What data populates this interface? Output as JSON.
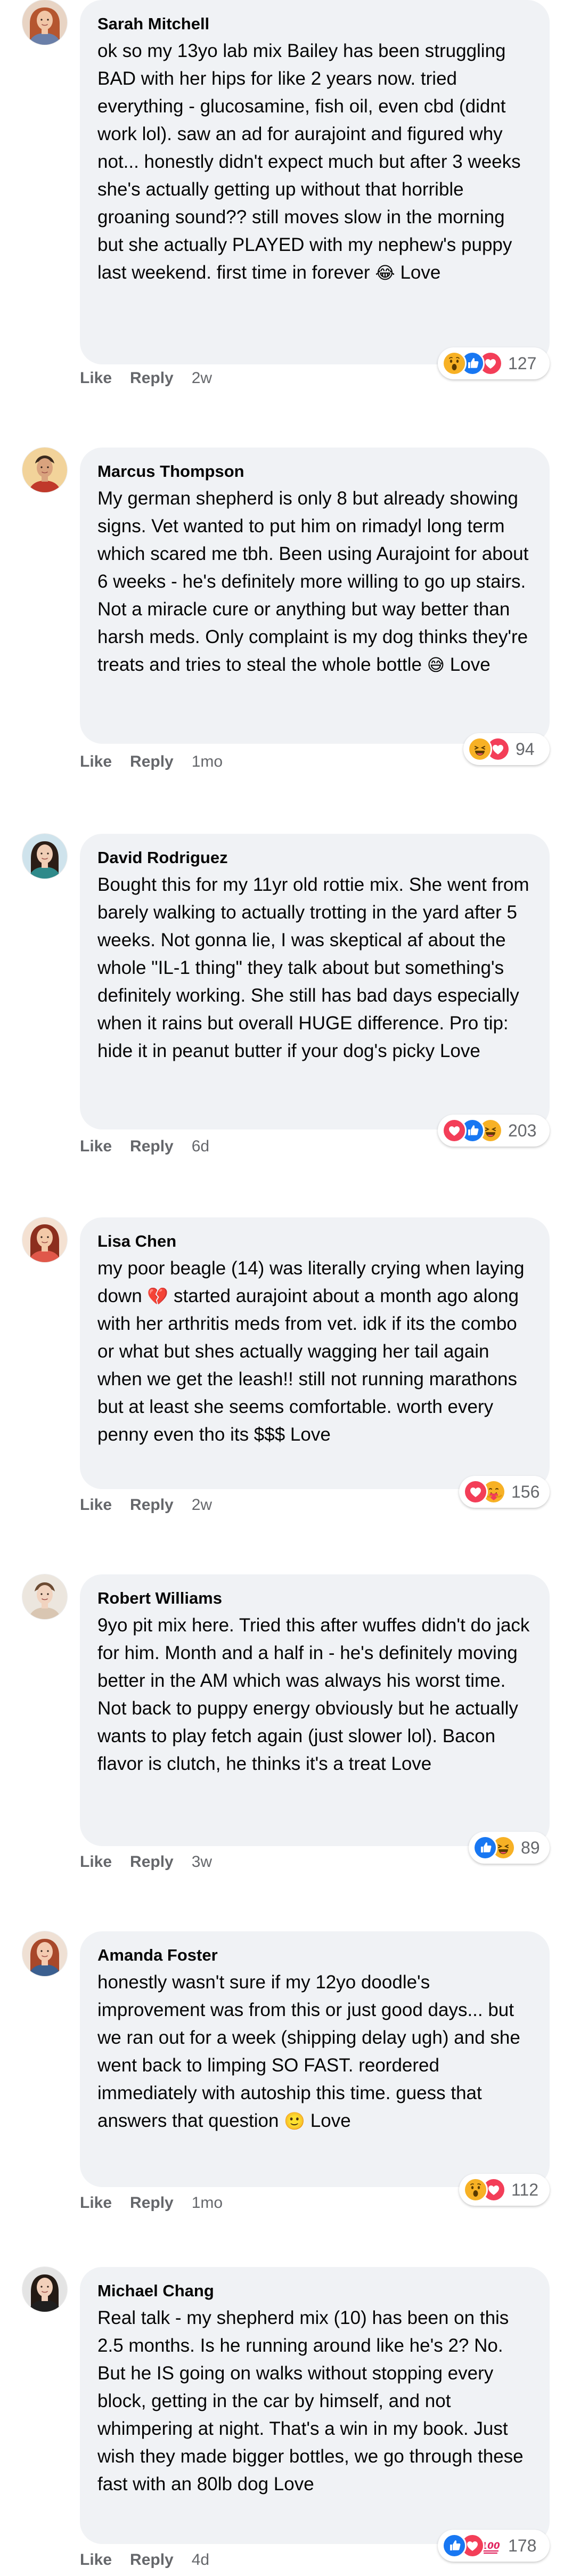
{
  "comments": [
    {
      "author": "Sarah Mitchell",
      "text": "ok so my 13yo lab mix Bailey has been struggling BAD with her hips for like 2 years now. tried everything - glucosamine, fish oil, even cbd (didnt work lol). saw an ad for aurajoint and figured why not... honestly didn't expect much but after 3 weeks she's actually getting up without that horrible groaning sound?? still moves slow in the morning but she actually PLAYED with my nephew's puppy last weekend. first time in forever",
      "emoji": "😂",
      "suffix": "Love",
      "reactions": [
        "wow",
        "like",
        "love"
      ],
      "reaction_count": "127",
      "like_label": "Like",
      "reply_label": "Reply",
      "time": "2w",
      "avatar": {
        "skin": "#f1c6a6",
        "hair": "#b5562f",
        "bg": "#e8d4c4",
        "shirt": "#6a7fa8"
      }
    },
    {
      "author": "Marcus Thompson",
      "text": "My german shepherd is only 8 but already showing signs. Vet wanted to put him on rimadyl long term which scared me tbh. Been using Aurajoint for about 6 weeks - he's definitely more willing to go up stairs. Not a miracle cure or anything but way better than harsh meds. Only complaint is my dog thinks they're treats and tries to steal the whole bottle",
      "emoji": "😅",
      "suffix": "Love",
      "reactions": [
        "haha",
        "love"
      ],
      "reaction_count": "94",
      "like_label": "Like",
      "reply_label": "Reply",
      "time": "1mo",
      "avatar": {
        "skin": "#d9a37e",
        "hair": "#3a2a1e",
        "bg": "#f2d39a",
        "shirt": "#c0392b"
      }
    },
    {
      "author": "David Rodriguez",
      "text": "Bought this for my 11yr old rottie mix. She went from barely walking to actually trotting in the yard after 5 weeks. Not gonna lie, I was skeptical af about the whole \"IL-1 thing\" they talk about but something's definitely working. She still has bad days especially when it rains but overall HUGE difference. Pro tip: hide it in peanut butter if your dog's picky Love",
      "emoji": "",
      "suffix": "",
      "reactions": [
        "love",
        "like",
        "haha"
      ],
      "reaction_count": "203",
      "like_label": "Like",
      "reply_label": "Reply",
      "time": "6d",
      "avatar": {
        "skin": "#f0cdb5",
        "hair": "#2b1d16",
        "bg": "#cfe3ec",
        "shirt": "#2f8a8a"
      }
    },
    {
      "author": "Lisa Chen",
      "text": "my poor beagle (14) was literally crying when laying down",
      "emoji": "💔",
      "text2": "started aurajoint about a month ago along with her arthritis meds from vet. idk if its the combo or what but shes actually wagging her tail again when we get the leash!! still not running marathons but at least she seems comfortable. worth every penny even tho its $$$ Love",
      "suffix": "",
      "reactions": [
        "love",
        "care"
      ],
      "reaction_count": "156",
      "like_label": "Like",
      "reply_label": "Reply",
      "time": "2w",
      "avatar": {
        "skin": "#f3c9a8",
        "hair": "#8c2f1e",
        "bg": "#f4e1d2",
        "shirt": "#e0584a"
      }
    },
    {
      "author": "Robert Williams",
      "text": "9yo pit mix here. Tried this after wuffes didn't do jack for him. Month and a half in - he's definitely moving better in the AM which was always his worst time. Not back to puppy energy obviously but he actually wants to play fetch again (just slower lol). Bacon flavor is clutch, he thinks it's a treat Love",
      "emoji": "",
      "suffix": "",
      "reactions": [
        "like",
        "haha"
      ],
      "reaction_count": "89",
      "like_label": "Like",
      "reply_label": "Reply",
      "time": "3w",
      "avatar": {
        "skin": "#f1d3bf",
        "hair": "#6b4a32",
        "bg": "#ece6de",
        "shirt": "#d9c6b2"
      }
    },
    {
      "author": "Amanda Foster",
      "text": "honestly wasn't sure if my 12yo doodle's improvement was from this or just good days... but we ran out for a week (shipping delay ugh) and she went back to limping SO FAST. reordered immediately with autoship this time. guess that answers that question",
      "emoji": "🙂",
      "suffix": "Love",
      "reactions": [
        "wow",
        "love"
      ],
      "reaction_count": "112",
      "like_label": "Like",
      "reply_label": "Reply",
      "time": "1mo",
      "avatar": {
        "skin": "#f4cbb0",
        "hair": "#a8482a",
        "bg": "#efe0d4",
        "shirt": "#3b5f8f"
      }
    },
    {
      "author": "Michael Chang",
      "text": "Real talk - my shepherd mix (10) has been on this 2.5 months. Is he running around like he's 2? No. But he IS going on walks without stopping every block, getting in the car by himself, and not whimpering at night. That's a win in my book. Just wish they made bigger bottles, we go through these fast with an 80lb dog Love",
      "emoji": "",
      "suffix": "",
      "reactions": [
        "like",
        "love",
        "hundred"
      ],
      "reaction_count": "178",
      "like_label": "Like",
      "reply_label": "Reply",
      "time": "4d",
      "avatar": {
        "skin": "#f2d0ba",
        "hair": "#241a14",
        "bg": "#e4e4e4",
        "shirt": "#1f1f1f"
      }
    }
  ],
  "colors": {
    "bubble_bg": "#f0f2f5",
    "meta_text": "#65676b",
    "like_blue": "#1877f2",
    "love_red": "#f33e58",
    "reaction_yellow": "#f7b125"
  }
}
